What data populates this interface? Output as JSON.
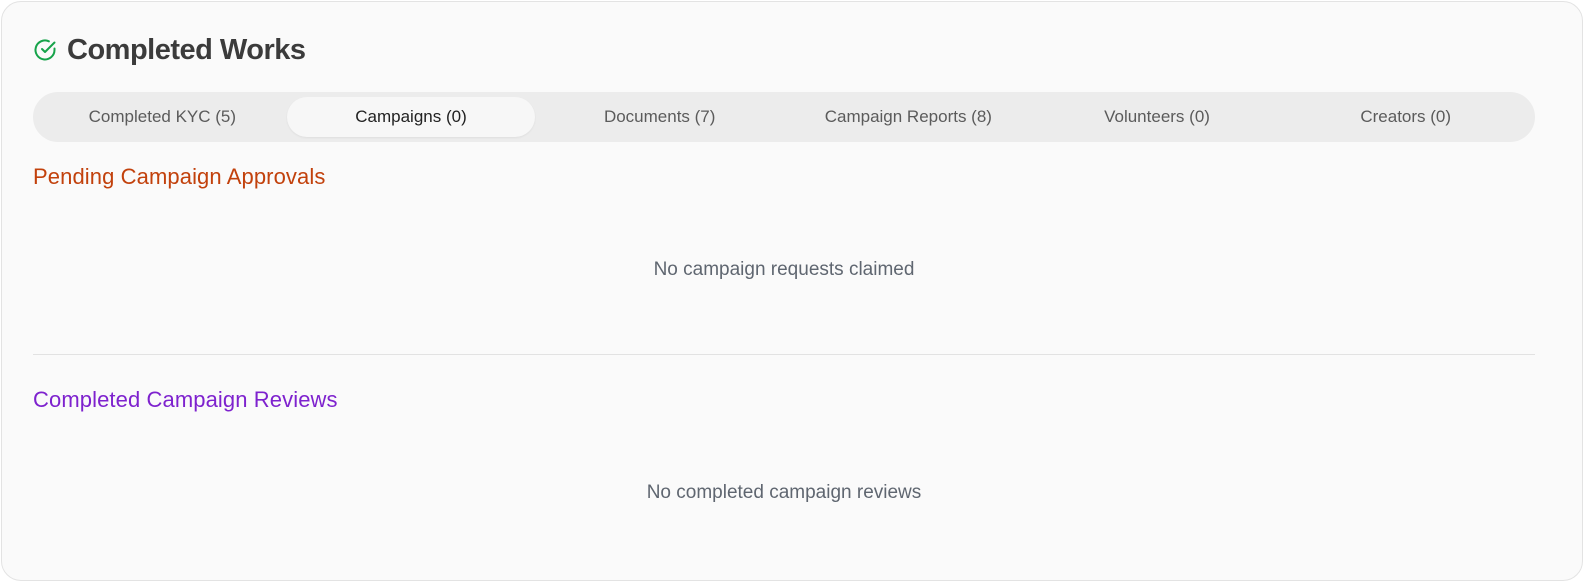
{
  "header": {
    "icon": "check-circle-icon",
    "title": "Completed Works",
    "icon_color": "#16a34a"
  },
  "tabs": [
    {
      "label": "Completed KYC (5)",
      "active": false
    },
    {
      "label": "Campaigns (0)",
      "active": true
    },
    {
      "label": "Documents (7)",
      "active": false
    },
    {
      "label": "Campaign Reports (8)",
      "active": false
    },
    {
      "label": "Volunteers (0)",
      "active": false
    },
    {
      "label": "Creators (0)",
      "active": false
    }
  ],
  "sections": {
    "pending": {
      "title": "Pending Campaign Approvals",
      "title_color": "#c2410c",
      "empty_text": "No campaign requests claimed"
    },
    "completed": {
      "title": "Completed Campaign Reviews",
      "title_color": "#7e22ce",
      "empty_text": "No completed campaign reviews"
    }
  }
}
